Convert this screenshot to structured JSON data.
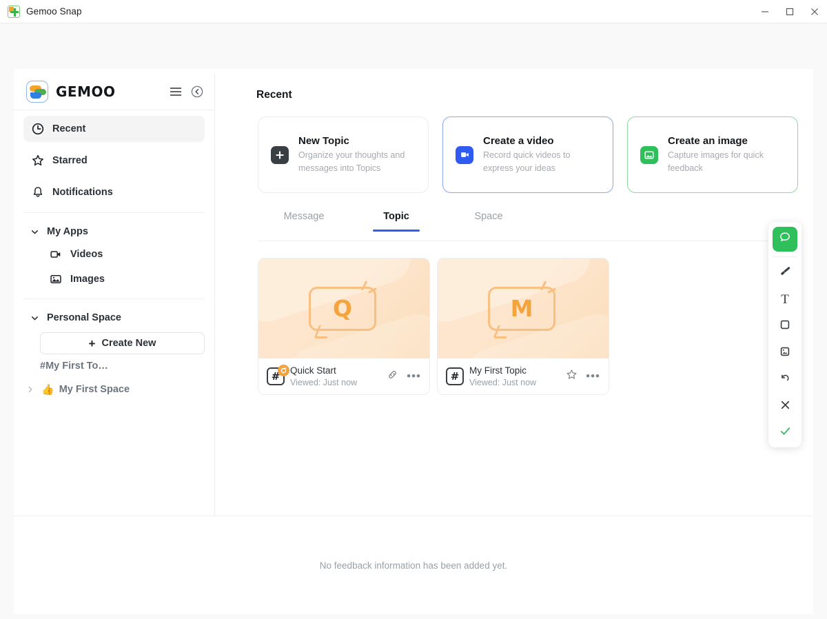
{
  "window": {
    "title": "Gemoo Snap",
    "app_icon": "gemoo-snap-icon",
    "controls": {
      "minimize": "minimize",
      "maximize": "maximize",
      "close": "close"
    }
  },
  "sidebar": {
    "brand": "GEMOO",
    "header_actions": [
      {
        "name": "menu-icon",
        "label": "Menu"
      },
      {
        "name": "collapse-sidebar-icon",
        "label": "Collapse"
      }
    ],
    "items": [
      {
        "label": "Recent",
        "icon": "clock-icon",
        "active": true
      },
      {
        "label": "Starred",
        "icon": "star-icon",
        "active": false
      },
      {
        "label": "Notifications",
        "icon": "bell-icon",
        "active": false
      }
    ],
    "my_apps": {
      "label": "My Apps",
      "children": [
        {
          "label": "Videos",
          "icon": "video-camera-icon"
        },
        {
          "label": "Images",
          "icon": "image-icon"
        }
      ]
    },
    "personal_space": {
      "label": "Personal Space",
      "create_new_label": "Create New",
      "create_new_icon": "plus-icon",
      "entries": [
        {
          "label": "#My First To…",
          "type": "topic"
        },
        {
          "label": "My First Space",
          "type": "space",
          "emoji": "👍"
        }
      ]
    }
  },
  "main": {
    "title": "Recent",
    "action_cards": [
      {
        "title": "New Topic",
        "desc": "Organize your thoughts and messages into Topics",
        "icon": "plus-square-icon",
        "accent": "#3a3f44",
        "style": "dark"
      },
      {
        "title": "Create a video",
        "desc": "Record quick videos to express your ideas",
        "icon": "video-camera-icon",
        "accent": "#2f5bf0",
        "style": "blue"
      },
      {
        "title": "Create an image",
        "desc": "Capture images for quick feedback",
        "icon": "image-icon",
        "accent": "#2fbf5b",
        "style": "green"
      }
    ],
    "tabs": [
      {
        "label": "Message",
        "active": false
      },
      {
        "label": "Topic",
        "active": true
      },
      {
        "label": "Space",
        "active": false
      }
    ],
    "topics": [
      {
        "name": "Quick Start",
        "status": "Viewed: Just now",
        "thumb_letter": "Q",
        "badge": "#",
        "badge_overlay": "sync-icon",
        "actions": [
          "link-icon",
          "more-options-icon"
        ]
      },
      {
        "name": "My First Topic",
        "status": "Viewed: Just now",
        "thumb_letter": "M",
        "badge": "#",
        "badge_overlay": null,
        "actions": [
          "star-icon",
          "more-options-icon"
        ]
      }
    ]
  },
  "toolbar": {
    "buttons": [
      {
        "name": "comment-tool",
        "icon": "comment-bubble-icon",
        "active": true
      },
      {
        "name": "brush-tool",
        "icon": "brush-icon",
        "active": false
      },
      {
        "name": "text-tool",
        "icon": "text-icon",
        "active": false,
        "glyph": "T"
      },
      {
        "name": "rectangle-tool",
        "icon": "rectangle-icon",
        "active": false
      },
      {
        "name": "image-tool",
        "icon": "image-stamp-icon",
        "active": false
      },
      {
        "name": "undo-tool",
        "icon": "undo-icon",
        "active": false
      },
      {
        "name": "close-tool",
        "icon": "close-icon",
        "active": false
      },
      {
        "name": "confirm-tool",
        "icon": "check-icon",
        "active": false
      }
    ]
  },
  "feedback": {
    "empty_text": "No feedback information has been added yet."
  },
  "colors": {
    "accent_blue": "#2f5bf0",
    "accent_green": "#2fbf5b",
    "accent_orange": "#f5a33c",
    "muted_text": "#9aa0a6"
  }
}
